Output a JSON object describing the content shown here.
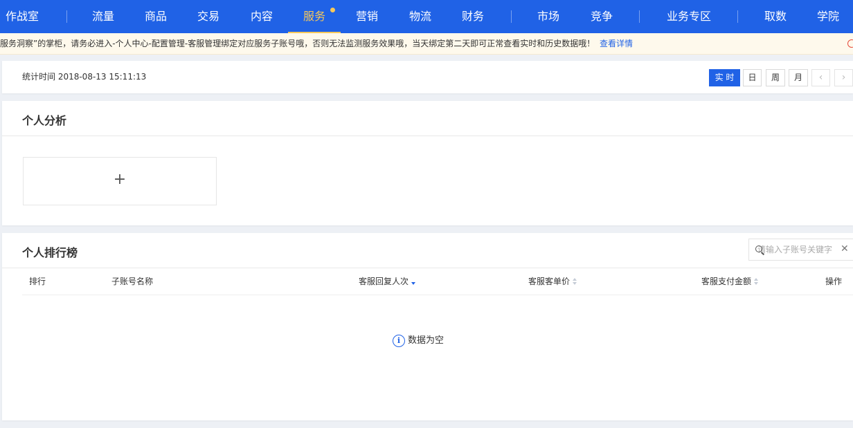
{
  "nav": {
    "items": [
      {
        "label": "作战室",
        "active": false
      },
      {
        "label": "流量",
        "active": false
      },
      {
        "label": "商品",
        "active": false
      },
      {
        "label": "交易",
        "active": false
      },
      {
        "label": "内容",
        "active": false
      },
      {
        "label": "服务",
        "active": true
      },
      {
        "label": "营销",
        "active": false
      },
      {
        "label": "物流",
        "active": false
      },
      {
        "label": "财务",
        "active": false
      },
      {
        "label": "市场",
        "active": false
      },
      {
        "label": "竞争",
        "active": false
      },
      {
        "label": "业务专区",
        "active": false
      },
      {
        "label": "取数",
        "active": false
      },
      {
        "label": "学院",
        "active": false
      }
    ]
  },
  "notice": {
    "text": "服务洞察”的掌柜，请务必进入-个人中心-配置管理-客服管理绑定对应服务子账号哦，否则无法监测服务效果哦，当天绑定第二天即可正常查看实时和历史数据哦！",
    "link": "查看详情"
  },
  "stat": {
    "time_text": "统计时间 2018-08-13 15:11:13",
    "periods": [
      {
        "label": "实 时",
        "active": true
      },
      {
        "label": "日",
        "active": false
      },
      {
        "label": "周",
        "active": false
      },
      {
        "label": "月",
        "active": false
      }
    ],
    "prev": "‹",
    "next": "›"
  },
  "personal_analysis": {
    "title": "个人分析",
    "add_symbol": "+"
  },
  "ranking": {
    "title": "个人排行榜",
    "search_placeholder": "请输入子账号关键字",
    "clear_symbol": "✕",
    "columns": [
      {
        "label": "排行",
        "sortable": false
      },
      {
        "label": "子账号名称",
        "sortable": false
      },
      {
        "label": "客服回复人次",
        "sortable": true,
        "sorted": "desc"
      },
      {
        "label": "客服客单价",
        "sortable": true
      },
      {
        "label": "客服支付金额",
        "sortable": true
      },
      {
        "label": "操作",
        "sortable": false
      }
    ],
    "empty_text": "数据为空",
    "empty_icon": "i"
  }
}
